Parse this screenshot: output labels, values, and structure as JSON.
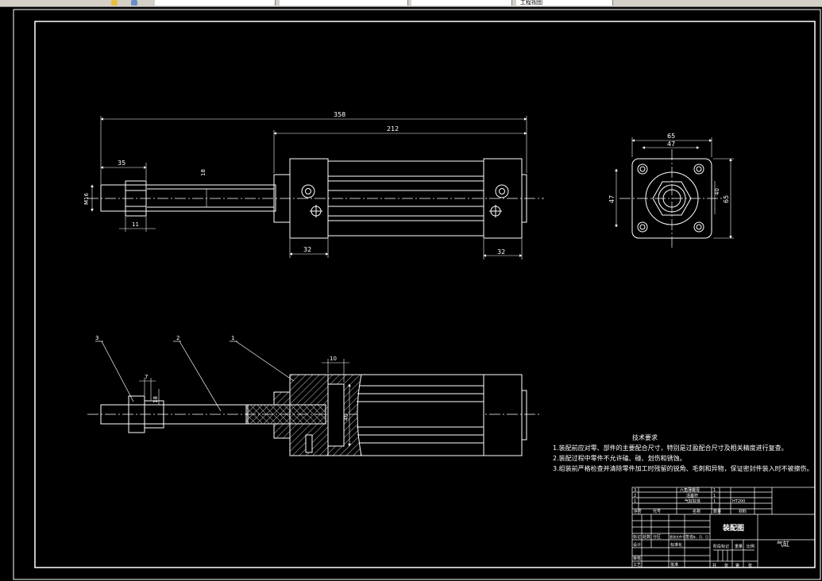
{
  "app": {
    "tabs": [
      {
        "label": ""
      },
      {
        "label": ""
      },
      {
        "label": ""
      },
      {
        "label": ""
      },
      {
        "label": "工程视图"
      }
    ]
  },
  "dims": {
    "overall": "358",
    "cylinder": "212",
    "rod_end": "35",
    "nut": "11",
    "rod_thread": "M16",
    "rod_dia": "18",
    "left_flange": "32",
    "right_flange": "32",
    "side_width": "65",
    "side_holes": "47",
    "side_height": "47",
    "side_total": "65",
    "side_bore": "40",
    "sec_step": "7",
    "sec_rod": "18",
    "sec_width": "10",
    "sec_bore": "40"
  },
  "balloons": [
    "3",
    "2",
    "1"
  ],
  "notes": {
    "title": "技术要求",
    "lines": [
      "1.装配前应对零、部件的主要配合尺寸，特别是过盈配合尺寸及相关精度进行复查。",
      "2.装配过程中零件不允许磕、碰、划伤和锈蚀。",
      "3.组装前严格检查并清除零件加工时残留的锐角、毛刺和异物，保证密封件装入时不被擦伤。"
    ]
  },
  "titleblock": {
    "bom": [
      {
        "no": "3",
        "name": "六角薄螺母",
        "qty": "1",
        "material": ""
      },
      {
        "no": "2",
        "name": "活塞杆",
        "qty": "1",
        "material": ""
      },
      {
        "no": "1",
        "name": "气缸缸体",
        "qty": "1",
        "material": "HT200"
      }
    ],
    "bom_header": [
      "序号",
      "代号",
      "名称",
      "数量",
      "材料"
    ],
    "drawing_name": "装配图",
    "part_name": "气缸",
    "signature_labels": [
      "标记",
      "处数",
      "分区",
      "更改文件号",
      "签名",
      "年、月、日"
    ],
    "design_row": [
      "设计",
      "",
      "标准化"
    ],
    "check_row": [
      "审核",
      ""
    ],
    "process_row": [
      "工艺",
      "",
      "批准"
    ],
    "stage_labels": [
      "阶段标记",
      "重量",
      "比例"
    ],
    "sheet_labels": [
      "共",
      "张",
      "第",
      "张"
    ]
  }
}
